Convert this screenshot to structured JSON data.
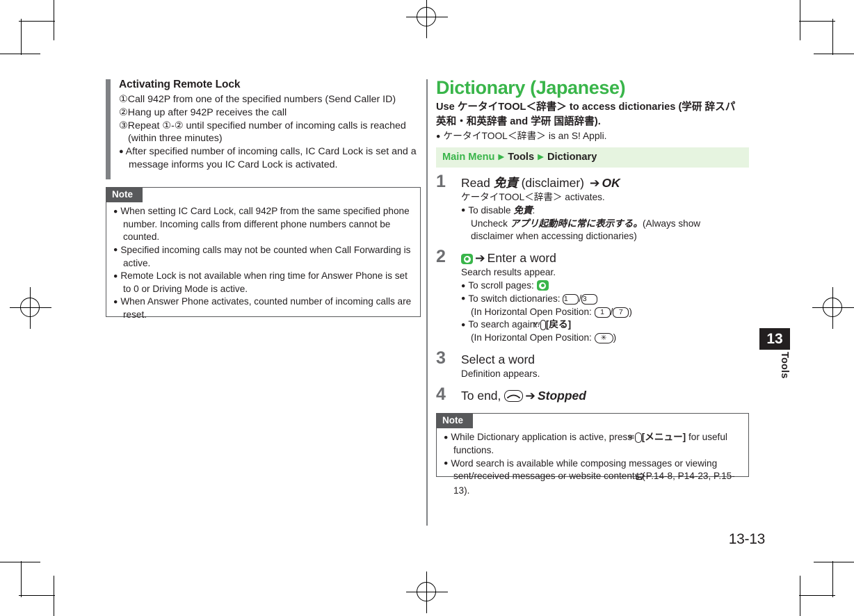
{
  "page": {
    "folio": "13-13",
    "thumb_tab_number": "13",
    "thumb_tab_label": "Tools",
    "accent_color": "#39b54a",
    "rule_color": "#808285",
    "note_tab_color": "#58595b"
  },
  "left_column": {
    "subhead": "Activating Remote Lock",
    "steps": [
      "①Call 942P from one of the specified numbers (Send Caller ID)",
      "②Hang up after 942P receives the call",
      "③Repeat ①-② until specified number of incoming calls is reached (within three minutes)"
    ],
    "bullet": "After specified number of incoming calls, IC Card Lock is set and a message informs you IC Card Lock is activated.",
    "note": {
      "label": "Note",
      "items": [
        "When setting IC Card Lock, call 942P from the same specified phone number. Incoming calls from different phone numbers cannot be counted.",
        "Specified incoming calls may not be counted when Call Forwarding is active.",
        "Remote Lock is not available when ring time for Answer Phone is set to 0 or Driving Mode is active.",
        "When Answer Phone activates, counted number of incoming calls are reset."
      ]
    }
  },
  "right_column": {
    "title": "Dictionary (Japanese)",
    "lede_line1": "Use ケータイTOOL＜辞書＞ to access dictionaries (学研 辞スパ",
    "lede_line2": "英和・和英辞書 and 学研 国語辞書).",
    "lede_bullet": "ケータイTOOL＜辞書＞ is an S! Appli.",
    "breadcrumb": {
      "root": "Main Menu",
      "level2": "Tools",
      "level3": "Dictionary"
    },
    "steps": [
      {
        "number": "1",
        "title_pre": "Read ",
        "title_jp": "免責",
        "title_mid": " (disclaimer) ",
        "arrow": "➔",
        "title_end": "OK",
        "sub": "ケータイTOOL＜辞書＞ activates.",
        "bullet_lead": "To disable ",
        "bullet_jp": "免責",
        "bullet_colon": ":",
        "bullet_line2_pre": "Uncheck ",
        "bullet_line2_jp": "アプリ起動時に常に表示する。",
        "bullet_line2_post": "(Always show",
        "bullet_line3": "disclaimer when accessing dictionaries)"
      },
      {
        "number": "2",
        "key_icon": "navigation-key-icon",
        "arrow": "➔",
        "title_end": "Enter a word",
        "sub": "Search results appear.",
        "b1_label": "To scroll pages: ",
        "b1_icon": "navigation-key-icon",
        "b2_label": "To switch dictionaries: ",
        "b2_key_a": "1",
        "b2_key_b": "3",
        "b2_sub_label": "(In Horizontal Open Position: ",
        "b2_sub_key_a": "1",
        "b2_sub_key_b": "7",
        "b2_sub_close": ")",
        "b3_label": "To search again: ",
        "b3_key": "Y!",
        "b3_soft": "[戻る]",
        "b3_sub_label": "(In Horizontal Open Position: ",
        "b3_sub_key": "✳",
        "b3_sub_close": ")"
      },
      {
        "number": "3",
        "title_end": "Select a word",
        "sub": "Definition appears."
      },
      {
        "number": "4",
        "title_pre": "To end, ",
        "key_icon": "end-call-key-icon",
        "arrow": "➔",
        "title_end": "Stopped"
      }
    ],
    "note": {
      "label": "Note",
      "item1_pre": "While Dictionary application is active, press ",
      "item1_key": "mail-key-icon",
      "item1_soft": "[メニュー]",
      "item1_post": " for useful functions.",
      "item2_pre": "Word search is available while composing messages or viewing sent/received messages or website contents (",
      "item2_ref_icon": "reference-hand-icon",
      "item2_refs": "P.14-8, P14-23, P.15-13)."
    }
  }
}
